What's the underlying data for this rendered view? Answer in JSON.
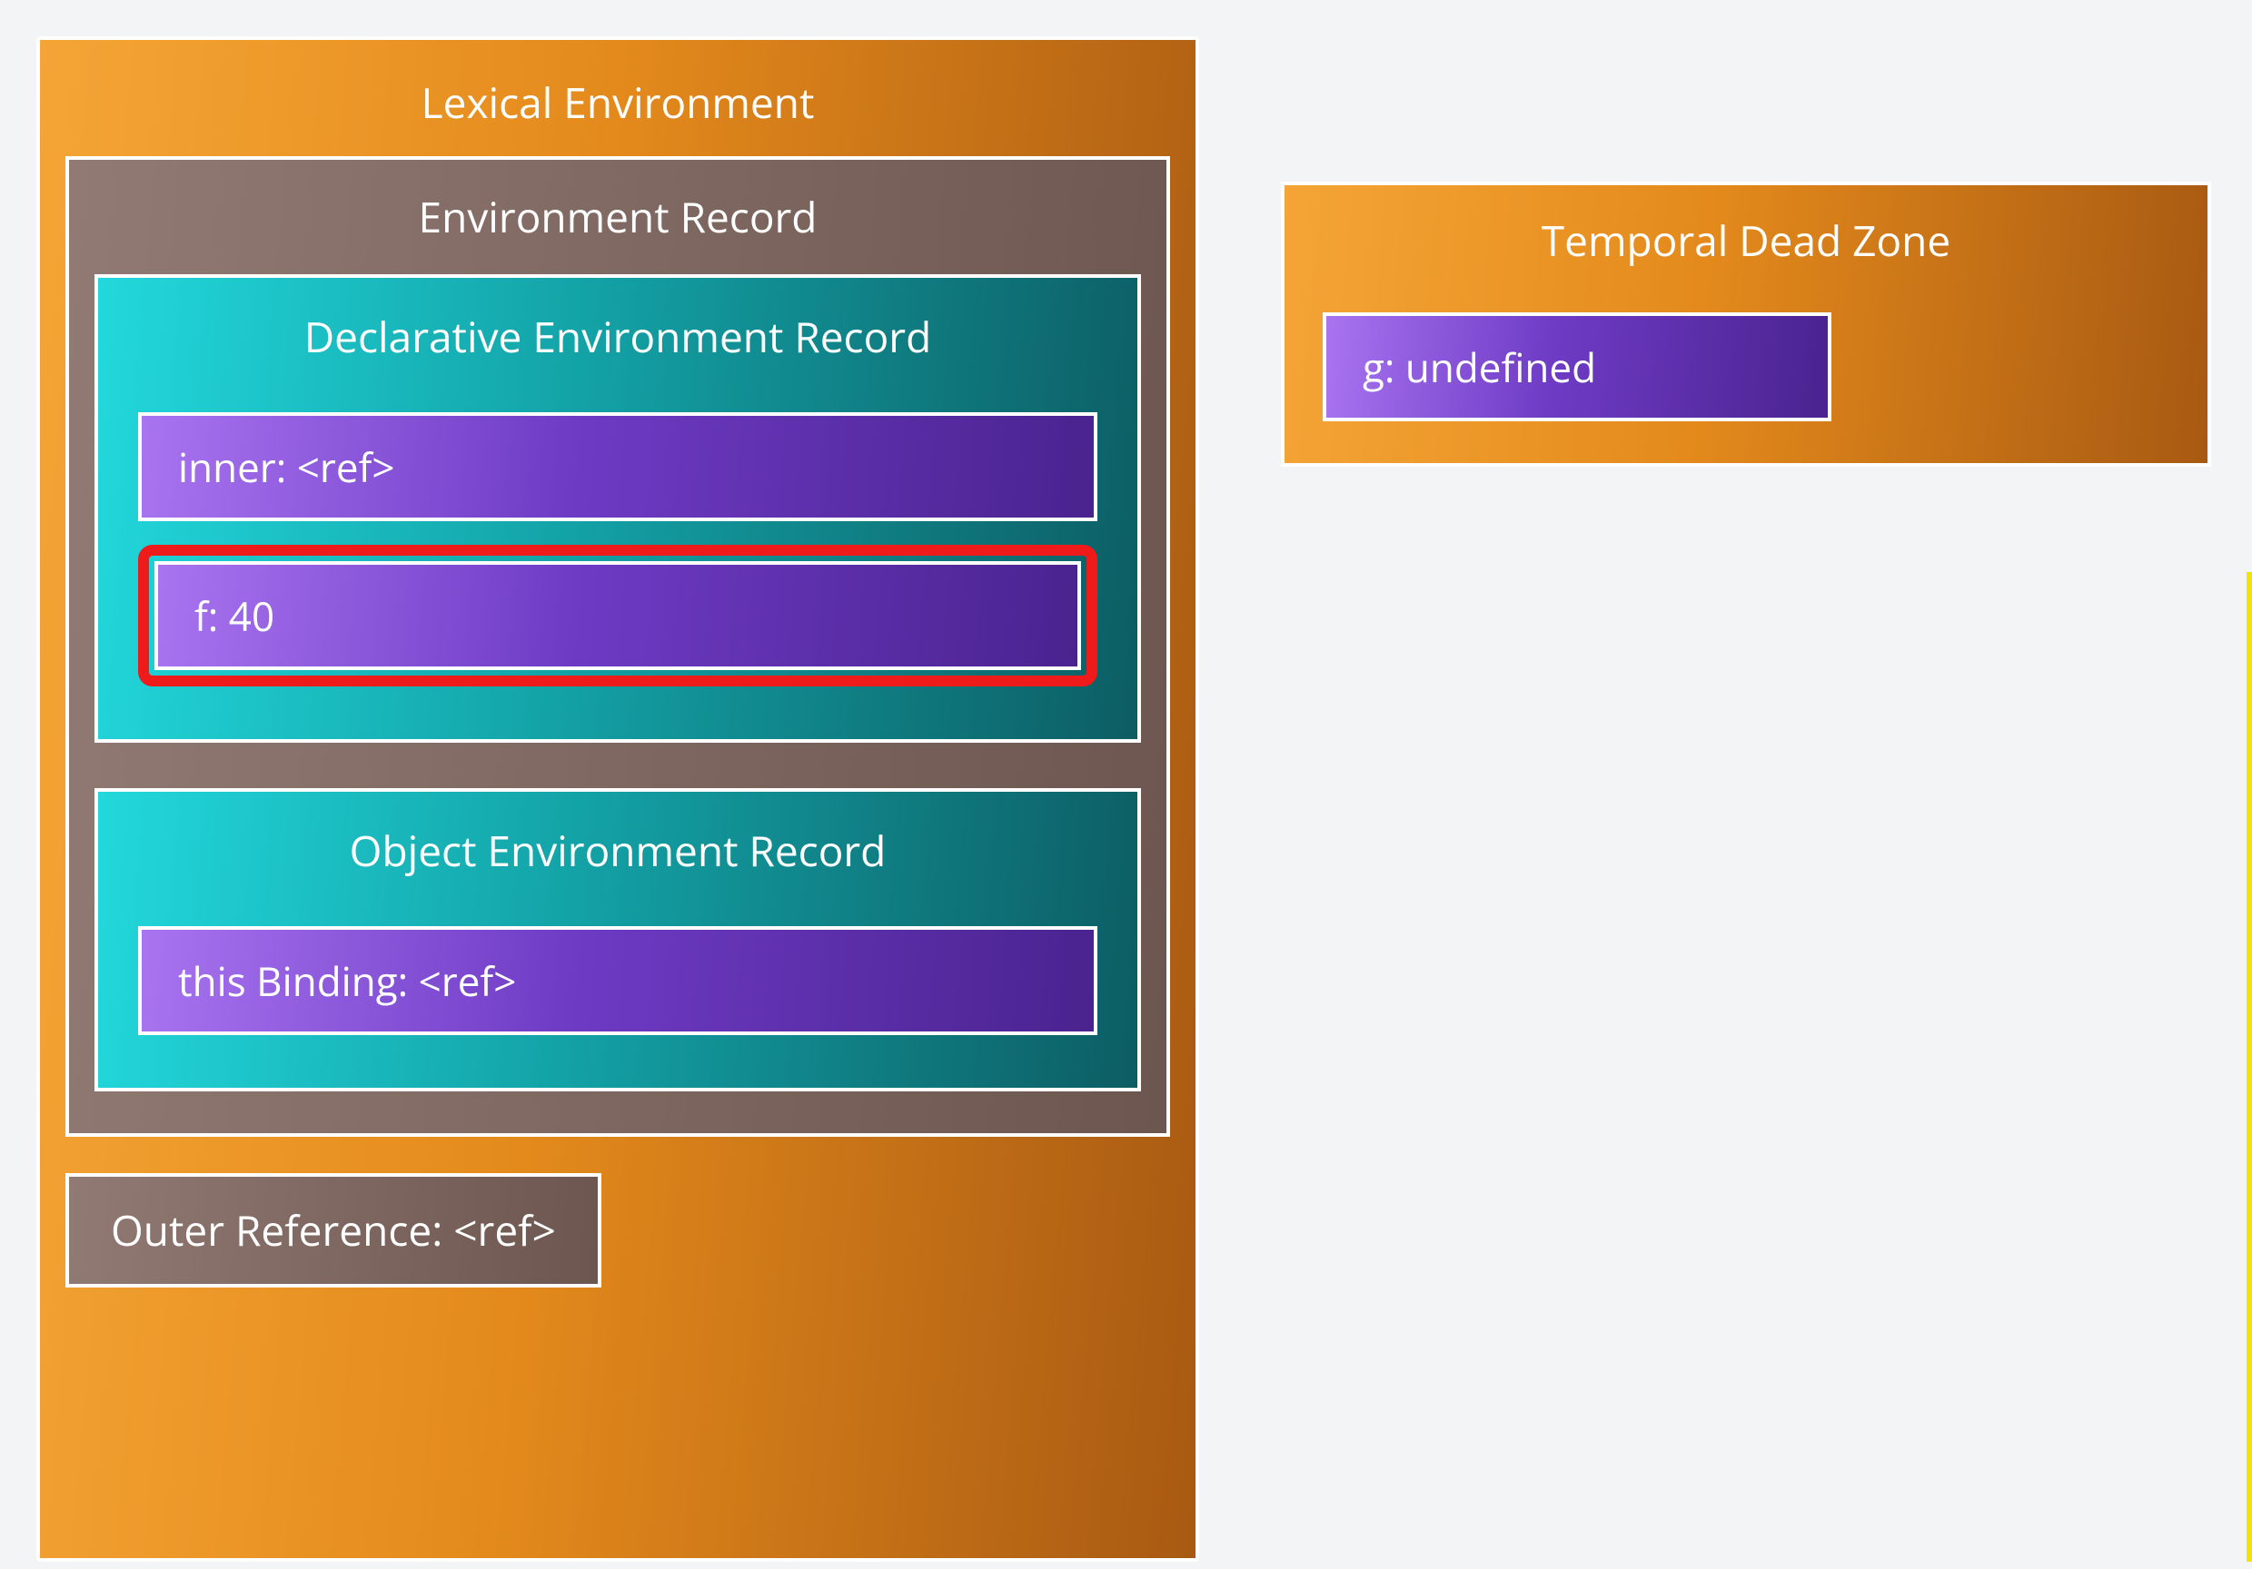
{
  "lexical_environment": {
    "title": "Lexical Environment",
    "environment_record": {
      "title": "Environment Record",
      "declarative": {
        "title": "Declarative Environment Record",
        "entries": [
          {
            "text": "inner: <ref>",
            "highlighted": false
          },
          {
            "text": "f: 40",
            "highlighted": true
          }
        ]
      },
      "object": {
        "title": "Object Environment Record",
        "entries": [
          {
            "text": "this Binding: <ref>"
          }
        ]
      }
    },
    "outer_reference": "Outer Reference: <ref>"
  },
  "temporal_dead_zone": {
    "title": "Temporal Dead Zone",
    "entries": [
      {
        "text": "g: undefined"
      }
    ]
  }
}
